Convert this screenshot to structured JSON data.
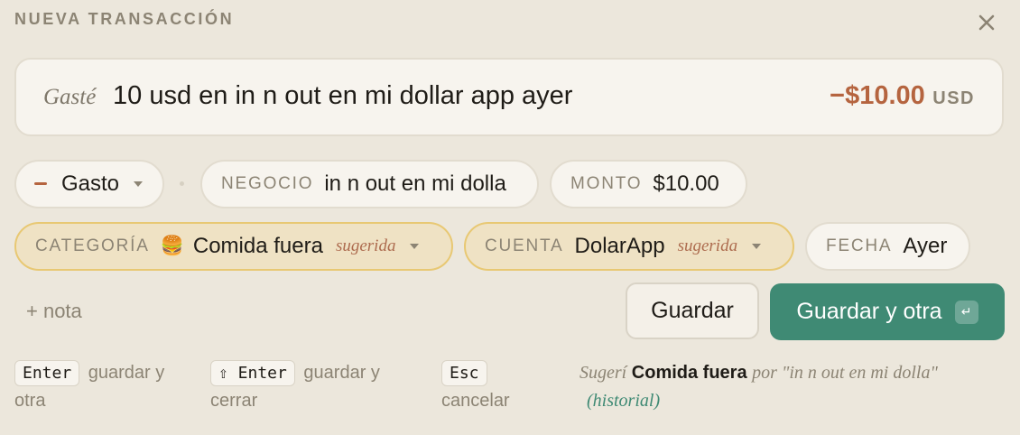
{
  "header": {
    "title": "NUEVA TRANSACCIÓN",
    "close_icon": "close-icon"
  },
  "entry": {
    "prefix": "Gasté",
    "text": "10 usd en in n out en mi dollar app ayer",
    "amount": "−$10.00",
    "currency": "USD"
  },
  "fields": {
    "type": {
      "value": "Gasto",
      "icon": "minus-icon"
    },
    "merchant": {
      "label": "NEGOCIO",
      "value": "in n out en mi dolla"
    },
    "amount": {
      "label": "MONTO",
      "value": "$10.00"
    },
    "category": {
      "label": "CATEGORÍA",
      "emoji": "🍔",
      "value": "Comida fuera",
      "hint": "sugerida"
    },
    "account": {
      "label": "CUENTA",
      "value": "DolarApp",
      "hint": "sugerida"
    },
    "date": {
      "label": "FECHA",
      "value": "Ayer"
    }
  },
  "actions": {
    "note": "+ nota",
    "save": "Guardar",
    "save_another": "Guardar y otra",
    "enter_glyph": "↵"
  },
  "shortcuts": [
    {
      "key": "Enter",
      "desc_1": "guardar y",
      "desc_2": "otra"
    },
    {
      "key": "⇧ Enter",
      "desc_1": "guardar y",
      "desc_2": "cerrar"
    },
    {
      "key": "Esc",
      "desc_1": "",
      "desc_2": "cancelar"
    }
  ],
  "suggestion": {
    "prefix": "Sugerí",
    "category": "Comida fuera",
    "middle": "por \"in n out en mi dolla\"",
    "source": "(historial)"
  },
  "colors": {
    "background": "#ece7dc",
    "accent_green": "#3f8a74",
    "amount_red": "#b5643f",
    "suggested_fill": "#efe2c4",
    "suggested_border": "#e8c873"
  }
}
